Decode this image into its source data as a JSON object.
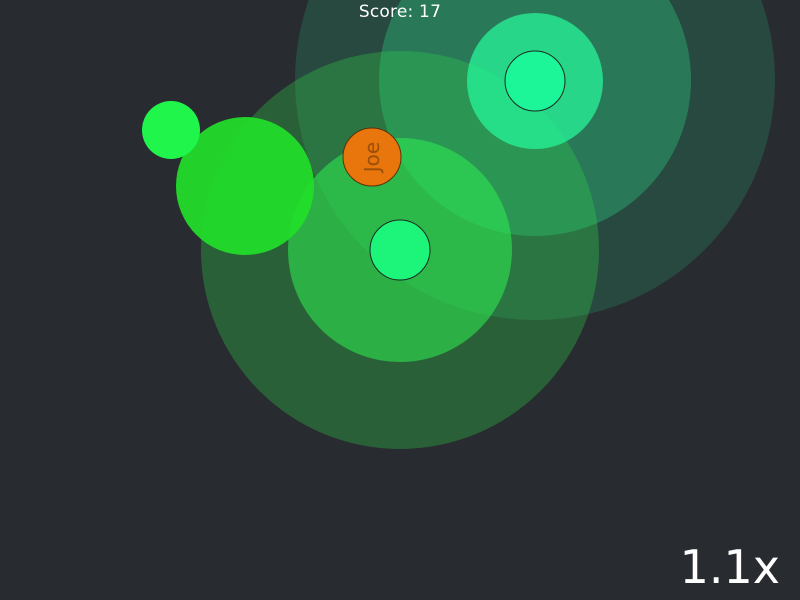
{
  "hud": {
    "score_label": "Score:",
    "score_value": "17",
    "speed_multiplier": "1.1x"
  },
  "player": {
    "name": "Joe",
    "color": "#e8760c"
  },
  "colors": {
    "background": "#282b30",
    "pulse_green": "#33d94a",
    "pulse_teal": "#2ee896",
    "bright_green_orb": "#22e02a",
    "small_green_orb": "#1ff54a",
    "core_green": "#1cf57a",
    "core_teal": "#1cf598"
  }
}
